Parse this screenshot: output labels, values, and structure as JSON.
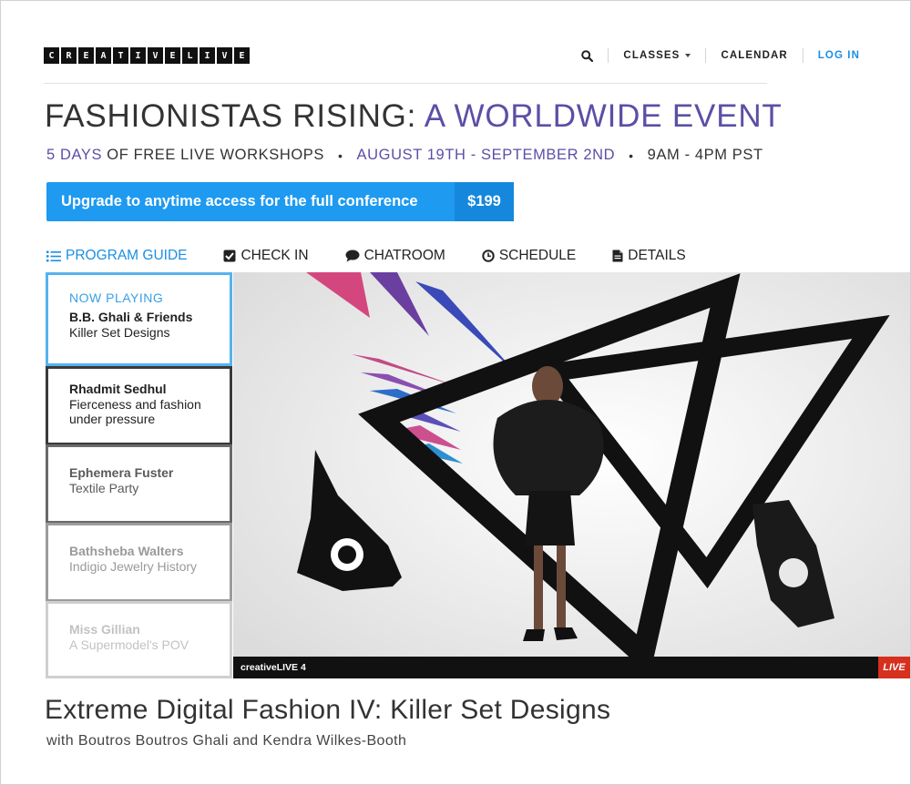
{
  "header": {
    "logo_letters": [
      "C",
      "R",
      "E",
      "A",
      "T",
      "I",
      "V",
      "E",
      "L",
      "I",
      "V",
      "E"
    ],
    "nav": {
      "search_icon": "search-icon",
      "classes": "CLASSES",
      "calendar": "CALENDAR",
      "login": "LOG IN"
    }
  },
  "event": {
    "title_main": "FASHIONISTAS RISING:",
    "title_accent": "A WORLDWIDE EVENT",
    "days": "5 DAYS",
    "workshops": "OF FREE LIVE WORKSHOPS",
    "dates": "AUGUST 19TH - SEPTEMBER 2ND",
    "hours": "9AM - 4PM PST",
    "separator": "•",
    "upgrade_label": "Upgrade to anytime access for the full conference",
    "upgrade_price": "$199"
  },
  "tabs": [
    {
      "label": "PROGRAM GUIDE",
      "icon": "list-icon",
      "active": true
    },
    {
      "label": "CHECK IN",
      "icon": "checkbox-icon",
      "active": false
    },
    {
      "label": "CHATROOM",
      "icon": "chat-bubble-icon",
      "active": false
    },
    {
      "label": "SCHEDULE",
      "icon": "clock-icon",
      "active": false
    },
    {
      "label": "DETAILS",
      "icon": "document-icon",
      "active": false
    }
  ],
  "program": {
    "now_playing_label": "NOW PLAYING",
    "items": [
      {
        "speaker": "B.B. Ghali & Friends",
        "topic": "Killer Set Designs"
      },
      {
        "speaker": "Rhadmit Sedhul",
        "topic": "Fierceness and fashion under pressure"
      },
      {
        "speaker": "Ephemera Fuster",
        "topic": "Textile Party"
      },
      {
        "speaker": "Bathsheba Walters",
        "topic": "Indigio Jewelry History"
      },
      {
        "speaker": "Miss Gillian",
        "topic": "A Supermodel's POV"
      }
    ]
  },
  "video": {
    "channel": "creativeLIVE 4",
    "live_badge": "LIVE"
  },
  "class": {
    "title": "Extreme Digital Fashion IV: Killer Set Designs",
    "instructors": "with Boutros Boutros Ghali and Kendra Wilkes-Booth"
  },
  "colors": {
    "accent_blue": "#1e9af0",
    "accent_purple": "#5b4fa6",
    "live_red": "#d6301e"
  }
}
